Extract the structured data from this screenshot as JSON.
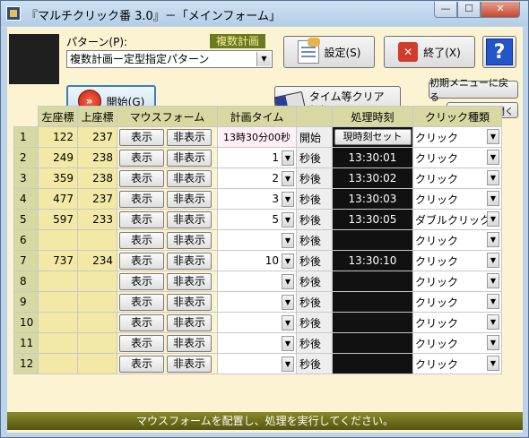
{
  "window": {
    "title": "『マルチクリック番 3.0』－「メインフォーム」",
    "controls": {
      "minimize": "—",
      "maximize": "☐",
      "close": "✕"
    }
  },
  "header": {
    "pattern_label": "パターン(P):",
    "badge": "複数計画",
    "pattern_selected": "複数計画ー定型指定パターン",
    "settings_label": "設定(S)",
    "end_label": "終了(X)",
    "help_label": "?",
    "start_label": "開始(G)",
    "time_clear_label": "タイム等クリア(C)",
    "init_menu_label": "初期メニューに戻る",
    "folder_label": "フォルダを開く"
  },
  "table": {
    "headers": {
      "left": "左座標",
      "top": "上座標",
      "mouse_form": "マウスフォーム",
      "plan_time": "計画タイム",
      "proc_time": "処理時刻",
      "click_type": "クリック種類"
    },
    "show_label": "表示",
    "hide_label": "非表示",
    "rows": [
      {
        "n": "1",
        "x": "122",
        "y": "237",
        "time": "13時30分00秒",
        "unit": "開始",
        "proc": "現時刻セット",
        "click": "クリック"
      },
      {
        "n": "2",
        "x": "249",
        "y": "238",
        "time": "1",
        "unit": "秒後",
        "proc": "13:30:01",
        "click": "クリック"
      },
      {
        "n": "3",
        "x": "359",
        "y": "238",
        "time": "2",
        "unit": "秒後",
        "proc": "13:30:02",
        "click": "クリック"
      },
      {
        "n": "4",
        "x": "477",
        "y": "237",
        "time": "3",
        "unit": "秒後",
        "proc": "13:30:03",
        "click": "クリック"
      },
      {
        "n": "5",
        "x": "597",
        "y": "233",
        "time": "5",
        "unit": "秒後",
        "proc": "13:30:05",
        "click": "ダブルクリック"
      },
      {
        "n": "6",
        "x": "",
        "y": "",
        "time": "",
        "unit": "秒後",
        "proc": "",
        "click": "クリック"
      },
      {
        "n": "7",
        "x": "737",
        "y": "234",
        "time": "10",
        "unit": "秒後",
        "proc": "13:30:10",
        "click": "クリック"
      },
      {
        "n": "8",
        "x": "",
        "y": "",
        "time": "",
        "unit": "秒後",
        "proc": "",
        "click": "クリック"
      },
      {
        "n": "9",
        "x": "",
        "y": "",
        "time": "",
        "unit": "秒後",
        "proc": "",
        "click": "クリック"
      },
      {
        "n": "10",
        "x": "",
        "y": "",
        "time": "",
        "unit": "秒後",
        "proc": "",
        "click": "クリック"
      },
      {
        "n": "11",
        "x": "",
        "y": "",
        "time": "",
        "unit": "秒後",
        "proc": "",
        "click": "クリック"
      },
      {
        "n": "12",
        "x": "",
        "y": "",
        "time": "",
        "unit": "秒後",
        "proc": "",
        "click": "クリック"
      }
    ]
  },
  "status": {
    "message": "マウスフォームを配置し、処理を実行してください。"
  },
  "icons": [
    "app-icon",
    "settings-icon",
    "close-x-icon",
    "help-icon",
    "start-icon",
    "eraser-icon",
    "dropdown-arrow-icon"
  ]
}
